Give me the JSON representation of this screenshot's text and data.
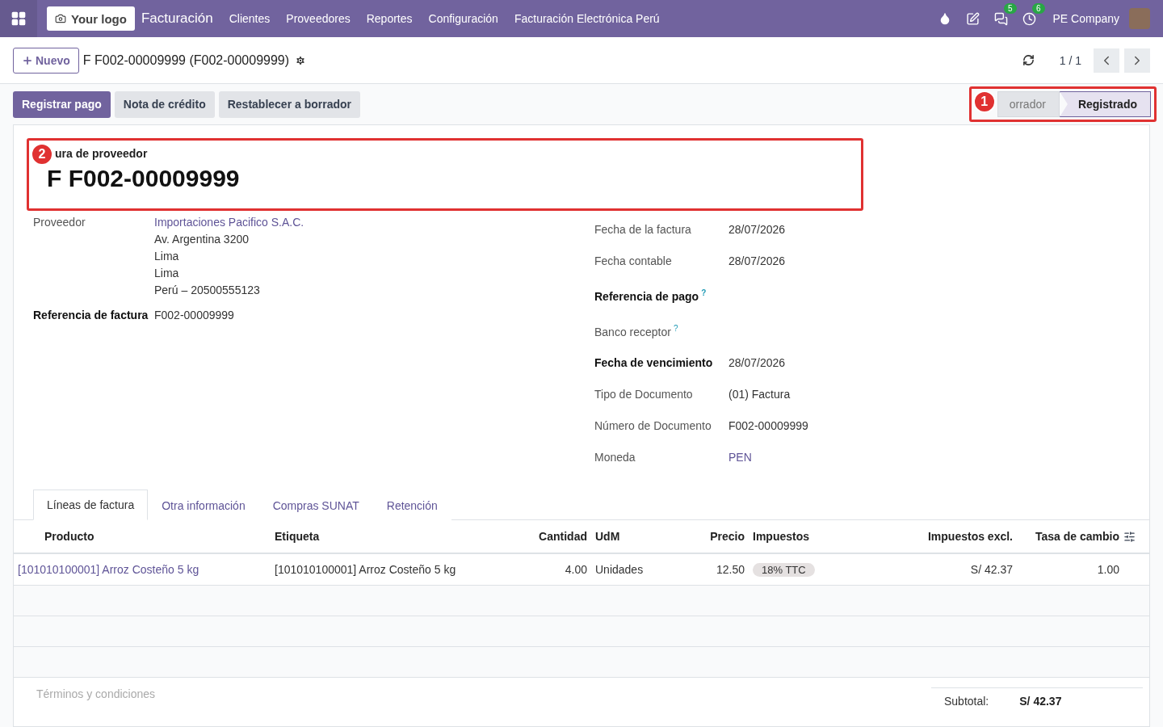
{
  "navbar": {
    "logo": "Your logo",
    "app": "Facturación",
    "menu": [
      "Clientes",
      "Proveedores",
      "Reportes",
      "Configuración",
      "Facturación Electrónica Perú"
    ],
    "systray": [
      {
        "kind": "drop"
      },
      {
        "kind": "edit"
      },
      {
        "kind": "chat",
        "count": "5"
      },
      {
        "kind": "clock",
        "count": "6"
      }
    ],
    "company": "PE Company"
  },
  "control_panel": {
    "new_button": "Nuevo",
    "breadcrumb": "F F002-00009999 (F002-00009999)",
    "pager": "1 / 1"
  },
  "actions": [
    {
      "label": "Registrar pago",
      "primary": true
    },
    {
      "label": "Nota de crédito",
      "primary": false
    },
    {
      "label": "Restablecer a borrador",
      "primary": false
    }
  ],
  "statusbar": [
    {
      "label": "orrador",
      "selected": false
    },
    {
      "label": "Registrado",
      "selected": true
    }
  ],
  "annotations": [
    "1",
    "2"
  ],
  "form": {
    "subtitle": "ura de proveedor",
    "title": "F F002-00009999",
    "left": [
      {
        "label": "Proveedor",
        "bold": false,
        "lines": [
          {
            "text": "Importaciones Pacifico S.A.C.",
            "link": true
          },
          {
            "text": "Av. Argentina 3200",
            "link": false
          },
          {
            "text": "Lima",
            "link": false
          },
          {
            "text": "Lima",
            "link": false
          },
          {
            "text": "Perú – 20500555123",
            "link": false
          }
        ]
      },
      {
        "label": "Referencia de factura",
        "bold": true,
        "lines": [
          {
            "text": "F002-00009999",
            "link": false
          }
        ]
      }
    ],
    "right": [
      {
        "label": "Fecha de la factura",
        "bold": false,
        "value": "28/07/2026"
      },
      {
        "label": "Fecha contable",
        "bold": false,
        "value": "28/07/2026"
      },
      {
        "label": "Referencia de pago",
        "bold": true,
        "help": "?"
      },
      {
        "label": "Banco receptor",
        "bold": false,
        "help": "?"
      },
      {
        "label": "Fecha de vencimiento",
        "bold": true,
        "value": "28/07/2026"
      },
      {
        "label": "Tipo de Documento",
        "bold": false,
        "value": "(01) Factura"
      },
      {
        "label": "Número de Documento",
        "bold": false,
        "value": "F002-00009999"
      },
      {
        "label": "Moneda",
        "bold": false,
        "value": "PEN",
        "link": true
      }
    ]
  },
  "tabs": [
    {
      "label": "Líneas de factura",
      "selected": true
    },
    {
      "label": "Otra información",
      "selected": false
    },
    {
      "label": "Compras SUNAT",
      "selected": false
    },
    {
      "label": "Retención",
      "selected": false
    }
  ],
  "table": {
    "columns": [
      "Producto",
      "Etiqueta",
      "Cantidad",
      "UdM",
      "Precio",
      "Impuestos",
      "Impuestos excl.",
      "Tasa de cambio"
    ],
    "rows": [
      {
        "cells": [
          "[101010100001] Arroz Costeño 5 kg",
          "[101010100001] Arroz Costeño 5 kg",
          "4.00",
          "Unidades",
          "12.50",
          "18% TTC",
          "S/ 42.37",
          "1.00"
        ]
      }
    ]
  },
  "footer": {
    "terms_placeholder": "Términos y condiciones",
    "subtotal_label": "Subtotal:",
    "subtotal_value": "S/ 42.37"
  }
}
